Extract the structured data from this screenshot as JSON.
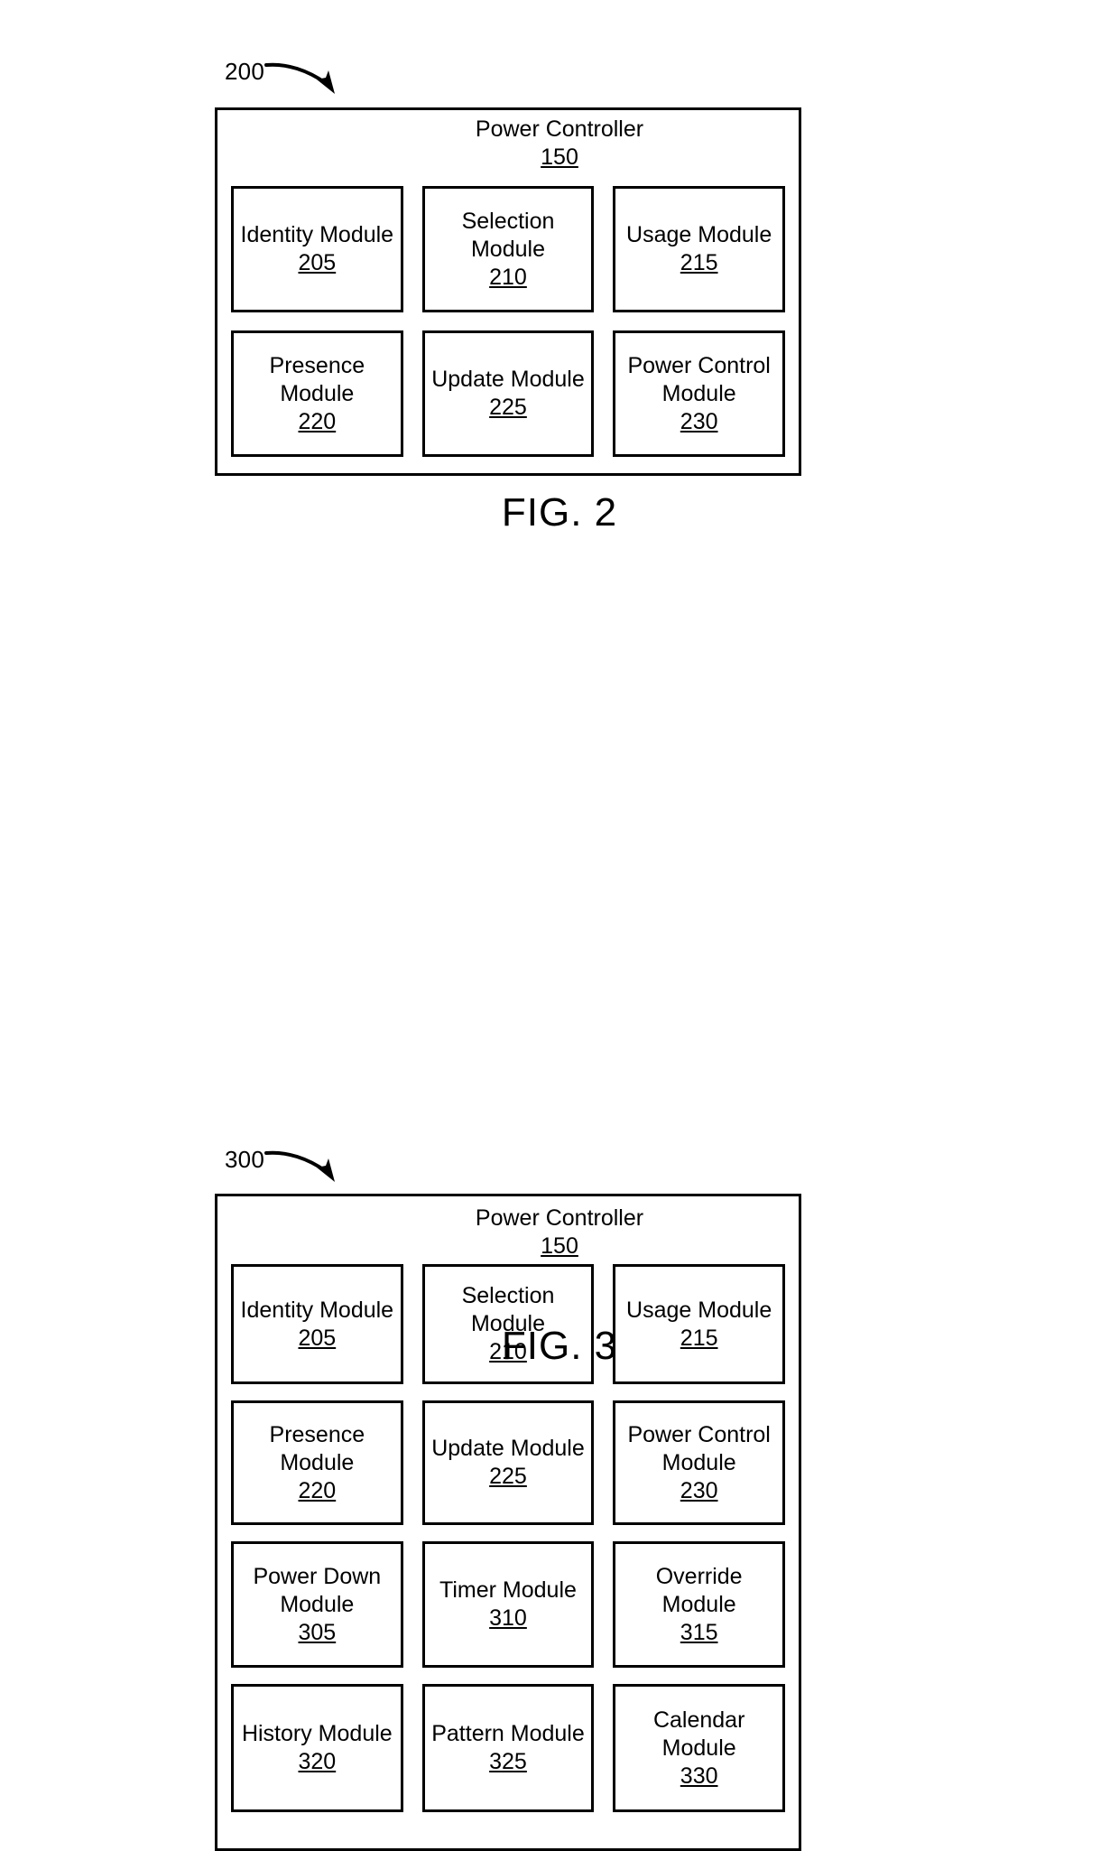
{
  "figures": [
    {
      "ref_number": "200",
      "caption": "FIG. 2",
      "container": {
        "title": "Power Controller",
        "number": "150"
      },
      "modules": [
        {
          "name": "Identity Module",
          "number": "205"
        },
        {
          "name": "Selection\nModule",
          "number": "210"
        },
        {
          "name": "Usage Module",
          "number": "215"
        },
        {
          "name": "Presence\nModule",
          "number": "220"
        },
        {
          "name": "Update Module",
          "number": "225"
        },
        {
          "name": "Power Control\nModule",
          "number": "230"
        }
      ]
    },
    {
      "ref_number": "300",
      "caption": "FIG. 3",
      "container": {
        "title": "Power Controller",
        "number": "150"
      },
      "modules": [
        {
          "name": "Identity Module",
          "number": "205"
        },
        {
          "name": "Selection\nModule",
          "number": "210"
        },
        {
          "name": "Usage Module",
          "number": "215"
        },
        {
          "name": "Presence\nModule",
          "number": "220"
        },
        {
          "name": "Update Module",
          "number": "225"
        },
        {
          "name": "Power Control\nModule",
          "number": "230"
        },
        {
          "name": "Power Down\nModule",
          "number": "305"
        },
        {
          "name": "Timer Module",
          "number": "310"
        },
        {
          "name": "Override\nModule",
          "number": "315"
        },
        {
          "name": "History Module",
          "number": "320"
        },
        {
          "name": "Pattern Module",
          "number": "325"
        },
        {
          "name": "Calendar\nModule",
          "number": "330"
        }
      ]
    }
  ],
  "colors": {
    "line": "#000000",
    "background": "#ffffff"
  }
}
